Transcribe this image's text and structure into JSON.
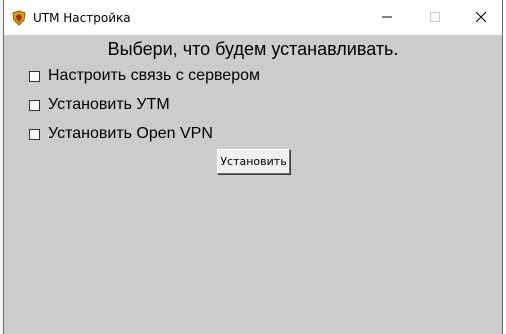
{
  "window": {
    "title": "UTM Настройка",
    "heading": "Выбери, что будем устанавливать."
  },
  "options": [
    {
      "label": "Настроить связь с сервером",
      "checked": false
    },
    {
      "label": "Установить УТМ",
      "checked": false
    },
    {
      "label": "Установить Open VPN",
      "checked": false
    }
  ],
  "install_button": {
    "label": "Установить"
  },
  "titlebar_icons": {
    "app": "shield-emblem-icon",
    "minimize": "minimize-icon",
    "maximize": "maximize-icon",
    "close": "close-icon"
  },
  "colors": {
    "client_bg": "#cccccc",
    "titlebar_bg": "#ffffff",
    "button_bg": "#f0f0f0"
  }
}
